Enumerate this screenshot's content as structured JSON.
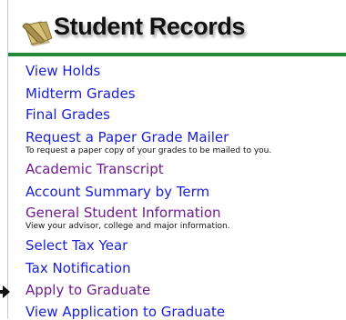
{
  "header": {
    "title": "Student Records",
    "icon": "scroll-icon"
  },
  "colors": {
    "link_unvisited": "#1a21d6",
    "link_visited": "#6e1c8f",
    "rule": "#1f8a3a"
  },
  "links": [
    {
      "label": "View Holds",
      "visited": false
    },
    {
      "label": "Midterm Grades",
      "visited": false
    },
    {
      "label": "Final Grades",
      "visited": false
    },
    {
      "label": "Request a Paper Grade Mailer",
      "visited": false,
      "description": "To request a paper copy of your grades to be mailed to you."
    },
    {
      "label": "Academic Transcript",
      "visited": true
    },
    {
      "label": "Account Summary by Term",
      "visited": false
    },
    {
      "label": "General Student Information",
      "visited": true,
      "description": "View your advisor, college and major information."
    },
    {
      "label": "Select Tax Year",
      "visited": false
    },
    {
      "label": "Tax Notification",
      "visited": false
    },
    {
      "label": "Apply to Graduate",
      "visited": true
    },
    {
      "label": "View Application to Graduate",
      "visited": false
    }
  ],
  "pointer_icon": "arrow-pointer-icon"
}
